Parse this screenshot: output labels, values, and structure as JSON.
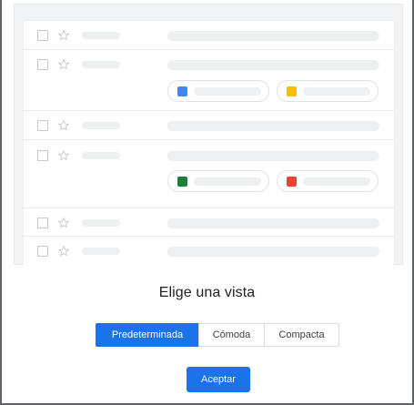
{
  "dialog": {
    "title": "Elige una vista",
    "options": [
      {
        "label": "Predeterminada",
        "selected": true
      },
      {
        "label": "Cómoda",
        "selected": false
      },
      {
        "label": "Compacta",
        "selected": false
      }
    ],
    "accept_label": "Aceptar"
  },
  "preview": {
    "attachment_icons": [
      "docs-icon",
      "slides-icon",
      "sheets-icon",
      "photo-icon"
    ]
  },
  "colors": {
    "accent": "#1a73e8",
    "docs": "#4285f4",
    "slides": "#fbbc04",
    "sheets": "#188038",
    "photo": "#ea4335"
  }
}
